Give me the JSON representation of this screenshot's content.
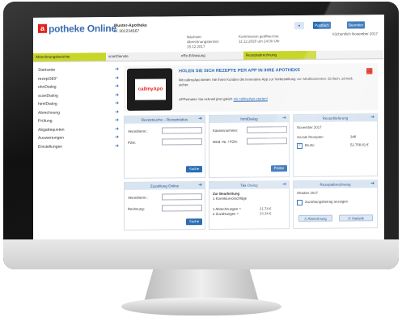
{
  "app": {
    "logo_letter": "a",
    "logo_text": "potheke Online",
    "pharmacy_name": "Muster-Apotheke",
    "pharmacy_id": "IK 301234567",
    "next_billing": "Nächster Abrechnungstermin: 15.12.2017",
    "contract_info": "Kommission geöffnet bis: 11.12.2020 um 14:00 Uhr",
    "buttons": [
      "Postfach",
      "Beenden"
    ],
    "week_label": "Vöchentlich November 2017"
  },
  "nav": {
    "tabs": [
      "Abrechnungsberichte",
      "scanDienste",
      "eRx-Erfassung",
      "Rezeptabrechnung"
    ]
  },
  "sidebar": {
    "items": [
      "Startseite",
      "rezept360°",
      "ohnDialog",
      "scanDialog",
      "htmlDialog",
      "Abrechnung",
      "Prüfung",
      "Abgabequoten",
      "Auswertungen",
      "Einstellungen"
    ]
  },
  "banner": {
    "title": "HOLEN SIE SICH REZEPTE PER APP IN IHRE APOTHEKE",
    "text": "Mit callmyApo bieten Sie Ihren Kunden die innovative App zur Vorbestellung von Medikamenten. Einfach, schnell, sicher.",
    "link_prefix": "APPerholen Sie schnell jetzt gleich",
    "link_text": "mit callmyApo starten!",
    "phone_brand": "callmyApo"
  },
  "cards": {
    "rezeptsuche": {
      "title": "Rezeptsuche – Rezeptstatus",
      "label1": "Verordnernr.:",
      "label2": "PZN:",
      "button": "Suche"
    },
    "html": {
      "title": "htmlDialog",
      "label1": "Kassennummer:",
      "label2": "Mind.-Nr. / PZN:",
      "button": "Prüfen"
    },
    "rezeptlieferung": {
      "title": "Rezeptlieferung",
      "month": "November 2017",
      "row1_label": "Anzahl Rezepten",
      "row1_value": "348",
      "row2_label": "Brutto",
      "row2_value": "52.768,81 €"
    },
    "zuzahlung": {
      "title": "Zuzahlung Online",
      "label1": "Verordnernr.:",
      "label2": "Rechnung:",
      "button": "Suche"
    },
    "tax": {
      "title": "Tax-Dialog",
      "heading": "Zur Bearbeitung",
      "line1": "1 Korrekturvorschläge",
      "line2_label": "1 Abrechnungen =",
      "line2_value": "21,74 €",
      "line3_label": "2 Zuzahlungen =",
      "line3_value": "33,34 €"
    },
    "rezeptabrechnung": {
      "title": "Rezeptabrechnung",
      "month": "Oktober 2017",
      "check_label": "Zuzahlungsbetrag anzeigen",
      "button1": "Abrechnung",
      "button2": "Statistik"
    }
  }
}
